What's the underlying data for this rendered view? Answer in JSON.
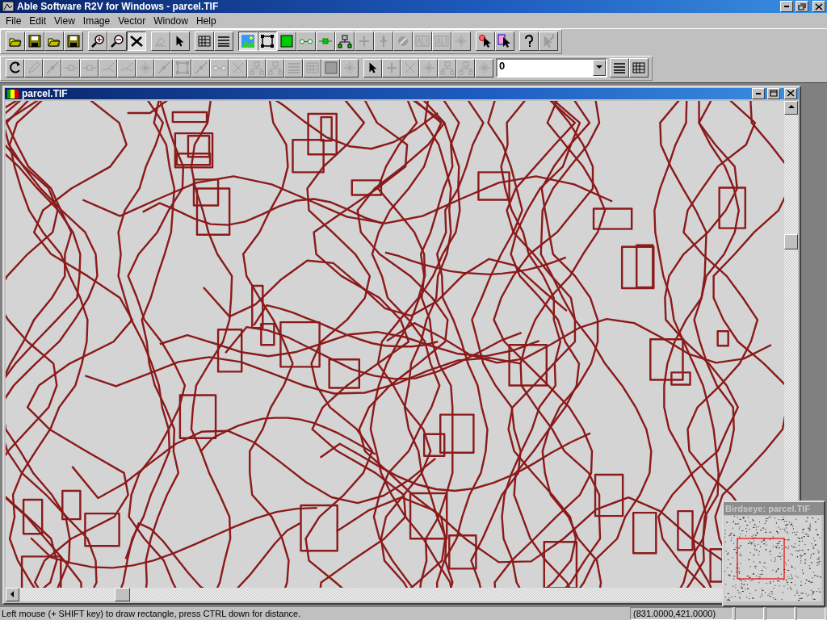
{
  "window": {
    "title": "Able Software R2V for Windows - parcel.TIF"
  },
  "menu": [
    {
      "label": "File"
    },
    {
      "label": "Edit"
    },
    {
      "label": "View"
    },
    {
      "label": "Image"
    },
    {
      "label": "Vector"
    },
    {
      "label": "Window"
    },
    {
      "label": "Help"
    }
  ],
  "toolbar_main": [
    {
      "pressed": false,
      "disabled": false
    },
    {
      "pressed": false,
      "disabled": false
    },
    {
      "pressed": false,
      "disabled": false
    },
    {
      "pressed": false,
      "disabled": false
    },
    {
      "pressed": false,
      "disabled": false
    },
    {
      "pressed": false,
      "disabled": false
    },
    {
      "pressed": true,
      "disabled": false
    },
    {
      "pressed": false,
      "disabled": true
    },
    {
      "pressed": false,
      "disabled": false
    },
    {
      "pressed": false,
      "disabled": false
    },
    {
      "pressed": false,
      "disabled": false
    },
    {
      "pressed": true,
      "disabled": false
    },
    {
      "pressed": true,
      "disabled": false
    },
    {
      "pressed": false,
      "disabled": false
    },
    {
      "pressed": false,
      "disabled": false
    },
    {
      "pressed": false,
      "disabled": false
    },
    {
      "pressed": false,
      "disabled": false
    },
    {
      "pressed": false,
      "disabled": true
    },
    {
      "pressed": false,
      "disabled": true
    },
    {
      "pressed": false,
      "disabled": true
    },
    {
      "pressed": false,
      "disabled": true
    },
    {
      "pressed": false,
      "disabled": true
    },
    {
      "pressed": false,
      "disabled": true
    },
    {
      "pressed": false,
      "disabled": false
    },
    {
      "pressed": false,
      "disabled": false
    },
    {
      "pressed": false,
      "disabled": false
    },
    {
      "pressed": false,
      "disabled": true
    }
  ],
  "toolbar_vector": [
    {
      "pressed": false,
      "disabled": false
    },
    {
      "pressed": false,
      "disabled": true
    },
    {
      "pressed": false,
      "disabled": true
    },
    {
      "pressed": false,
      "disabled": true
    },
    {
      "pressed": false,
      "disabled": true
    },
    {
      "pressed": false,
      "disabled": true
    },
    {
      "pressed": false,
      "disabled": true
    },
    {
      "pressed": false,
      "disabled": true
    },
    {
      "pressed": false,
      "disabled": true
    },
    {
      "pressed": false,
      "disabled": true
    },
    {
      "pressed": false,
      "disabled": true
    },
    {
      "pressed": false,
      "disabled": true
    },
    {
      "pressed": false,
      "disabled": true
    },
    {
      "pressed": false,
      "disabled": true
    },
    {
      "pressed": false,
      "disabled": true
    },
    {
      "pressed": false,
      "disabled": true
    },
    {
      "pressed": false,
      "disabled": true
    },
    {
      "pressed": false,
      "disabled": true
    },
    {
      "pressed": false,
      "disabled": true
    },
    {
      "pressed": false,
      "disabled": false
    },
    {
      "pressed": false,
      "disabled": true
    },
    {
      "pressed": false,
      "disabled": true
    },
    {
      "pressed": false,
      "disabled": true
    },
    {
      "pressed": false,
      "disabled": true
    },
    {
      "pressed": false,
      "disabled": true
    },
    {
      "pressed": false,
      "disabled": true
    }
  ],
  "layer_select": {
    "value": "0"
  },
  "toolbar_layers": [
    {
      "pressed": false,
      "disabled": false
    },
    {
      "pressed": false,
      "disabled": false
    }
  ],
  "document": {
    "title": "parcel.TIF"
  },
  "birdseye": {
    "title": "Birdseye: parcel.TIF"
  },
  "status_bar": {
    "message": "Left mouse (+ SHIFT key) to draw rectangle, press CTRL down for distance.",
    "coordinates": "(831.0000,421.0000)"
  }
}
